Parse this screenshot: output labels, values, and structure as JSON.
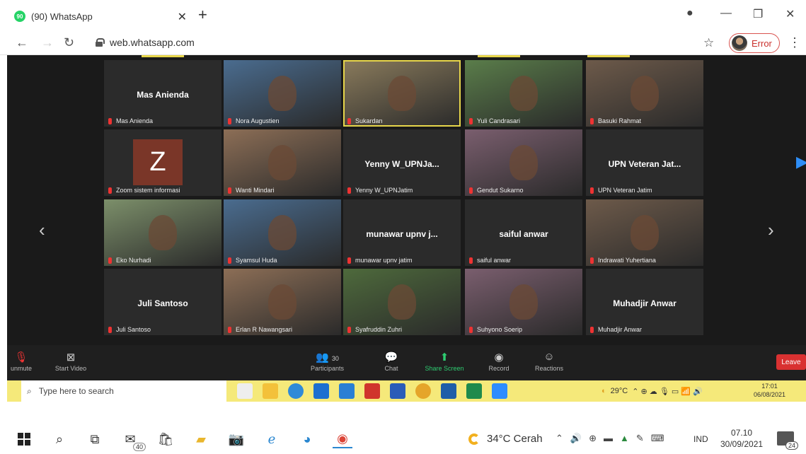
{
  "browser": {
    "tab_title": "(90) WhatsApp",
    "tab_badge": "90",
    "url": "web.whatsapp.com",
    "profile_status": "Error"
  },
  "meeting": {
    "participants": [
      {
        "display": "Mas Anienda",
        "label": "Mas Anienda",
        "video": false
      },
      {
        "display": "",
        "label": "Nora Augustien",
        "video": true
      },
      {
        "display": "",
        "label": "Sukardan",
        "video": true,
        "active": true
      },
      {
        "display": "",
        "label": "Yuli Candrasari",
        "video": true
      },
      {
        "display": "",
        "label": "Basuki Rahmat",
        "video": true
      },
      {
        "display": "Z",
        "label": "Zoom sistem informasi",
        "video": false,
        "avatar": true
      },
      {
        "display": "",
        "label": "Wanti Mindari",
        "video": true
      },
      {
        "display": "Yenny W_UPNJa...",
        "label": "Yenny W_UPNJatim",
        "video": false
      },
      {
        "display": "",
        "label": "Gendut Sukarno",
        "video": true
      },
      {
        "display": "UPN Veteran Jat...",
        "label": "UPN Veteran Jatim",
        "video": false
      },
      {
        "display": "",
        "label": "Eko Nurhadi",
        "video": true
      },
      {
        "display": "",
        "label": "Syamsul Huda",
        "video": true
      },
      {
        "display": "munawar upnv j...",
        "label": "munawar upnv jatim",
        "video": false
      },
      {
        "display": "saiful anwar",
        "label": "saiful anwar",
        "video": false
      },
      {
        "display": "",
        "label": "Indrawati Yuhertiana",
        "video": true
      },
      {
        "display": "Juli Santoso",
        "label": "Juli Santoso",
        "video": false
      },
      {
        "display": "",
        "label": "Erlan R Nawangsari",
        "video": true
      },
      {
        "display": "",
        "label": "Syafruddin Zuhri",
        "video": true
      },
      {
        "display": "",
        "label": "Suhyono Soerip",
        "video": true
      },
      {
        "display": "Muhadjir Anwar",
        "label": "Muhadjir Anwar",
        "video": false
      }
    ],
    "controls": {
      "mute": "unmute",
      "video": "Start Video",
      "participants": "Participants",
      "participants_count": "30",
      "chat": "Chat",
      "share": "Share Screen",
      "record": "Record",
      "reactions": "Reactions",
      "leave": "Leave"
    }
  },
  "inner_taskbar": {
    "search_placeholder": "Type here to search",
    "temp": "29°C",
    "time": "17:01",
    "date": "06/08/2021"
  },
  "taskbar": {
    "mail_badge": "40",
    "weather": "34°C  Cerah",
    "lang": "IND",
    "time": "07.10",
    "date": "30/09/2021",
    "notifications": "24"
  },
  "colors": {
    "zoom_bg": "#1a1a1a",
    "tile_bg": "#2b2b2b",
    "highlight": "#e7d64a",
    "leave": "#d93131",
    "share": "#2ecc71",
    "inner_taskbar": "#f5e97a"
  }
}
